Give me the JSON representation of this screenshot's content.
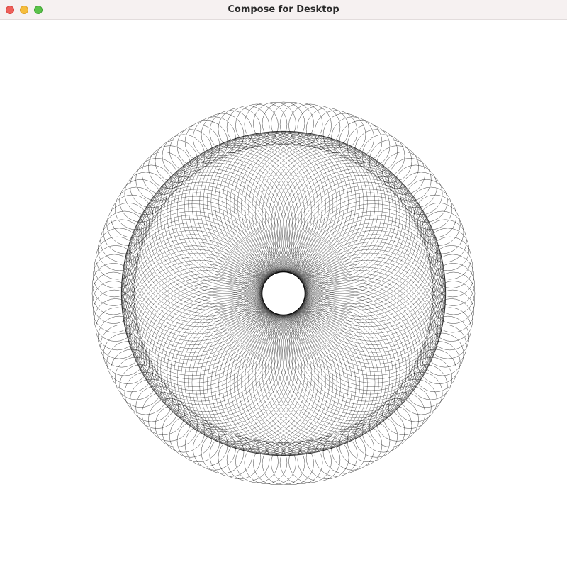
{
  "window": {
    "title": "Compose for Desktop",
    "buttons": {
      "close": "close-button",
      "minimize": "minimize-button",
      "maximize": "maximize-button"
    },
    "colors": {
      "close": "#ee5f5a",
      "minimize": "#f6bd3b",
      "maximize": "#5ac24a",
      "titlebar": "#f6f1f1"
    }
  },
  "pattern": {
    "stroke_color": "#000000",
    "background": "#ffffff"
  }
}
